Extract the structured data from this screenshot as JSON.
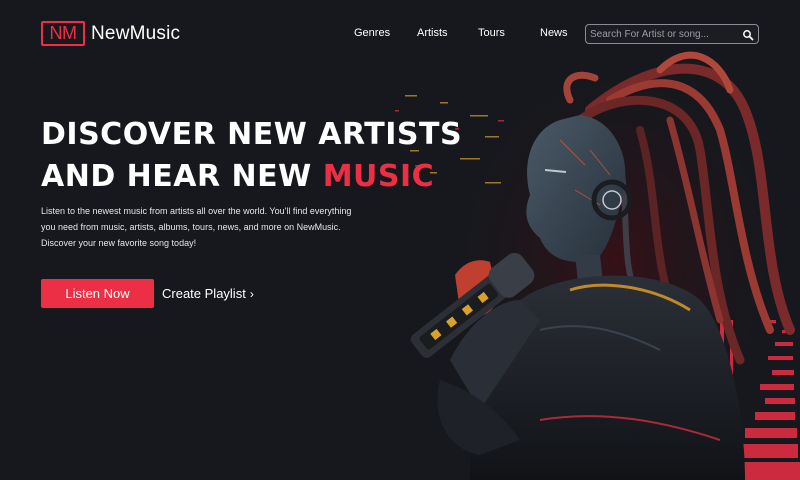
{
  "brand": {
    "mark": "NM",
    "name": "NewMusic",
    "accent_color": "#ec2f45"
  },
  "nav": {
    "links": [
      {
        "label": "Genres"
      },
      {
        "label": "Artists"
      },
      {
        "label": "Tours"
      },
      {
        "label": "News"
      }
    ],
    "search": {
      "placeholder": "Search For Artist or song...",
      "icon": "search-icon"
    }
  },
  "hero": {
    "headline_line1": "DISCOVER NEW ARTISTS",
    "headline_line2_prefix": "AND HEAR NEW",
    "headline_line2_accent": "MUSIC",
    "description": "Listen to the newest music from artists all over the world. You'll find everything you need from music, artists, albums, tours, news, and more on NewMusic. Discover your new favorite song today!",
    "primary_cta": "Listen Now",
    "secondary_cta": "Create Playlist",
    "secondary_icon": "chevron-right-icon",
    "illustration": "woman-with-dreadlocks-singing-into-microphone"
  },
  "colors": {
    "background": "#16181d",
    "accent": "#ec2f45",
    "text": "#ffffff"
  }
}
